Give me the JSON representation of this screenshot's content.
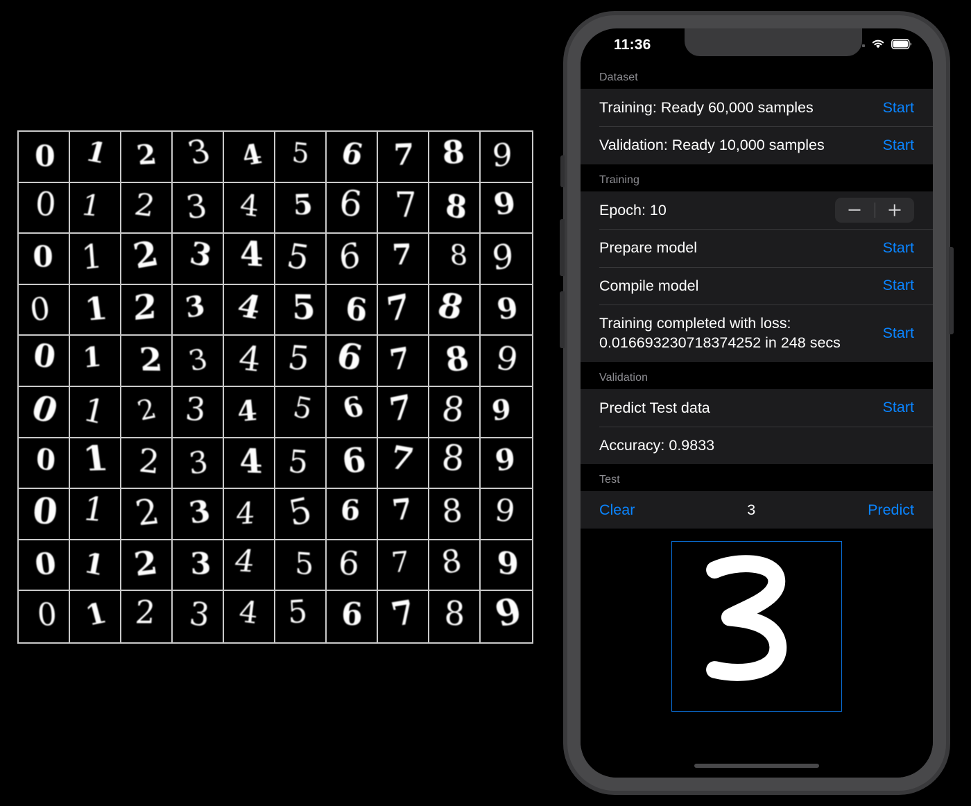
{
  "phone": {
    "status_bar": {
      "time": "11:36",
      "signal_icon": "signal-dots-icon",
      "wifi_icon": "wifi-icon",
      "battery_icon": "battery-icon"
    },
    "home_indicator": "home-indicator"
  },
  "app": {
    "sections": [
      {
        "header": "Dataset",
        "rows": [
          {
            "label": "Training: Ready   60,000 samples",
            "action": "Start"
          },
          {
            "label": "Validation: Ready   10,000 samples",
            "action": "Start"
          }
        ]
      },
      {
        "header": "Training",
        "rows": [
          {
            "label": "Epoch:  10",
            "control": "stepper"
          },
          {
            "label": "Prepare model",
            "action": "Start"
          },
          {
            "label": "Compile model",
            "action": "Start"
          },
          {
            "label": "Training completed with loss: 0.016693230718374252 in 248 secs",
            "action": "Start"
          }
        ]
      },
      {
        "header": "Validation",
        "rows": [
          {
            "label": "Predict Test data",
            "action": "Start"
          },
          {
            "label": "Accuracy: 0.9833",
            "action": ""
          }
        ]
      },
      {
        "header": "Test",
        "rows": [
          {
            "clear": "Clear",
            "value": "3",
            "predict": "Predict"
          }
        ]
      }
    ],
    "epoch": {
      "label": "Epoch:",
      "value": "10",
      "decrement_icon": "minus-icon",
      "increment_icon": "plus-icon"
    },
    "dataset": {
      "training_status": "Ready",
      "training_samples": "60,000 samples",
      "validation_status": "Ready",
      "validation_samples": "10,000 samples"
    },
    "training": {
      "loss": "0.016693230718374252",
      "duration_secs": "248"
    },
    "validation": {
      "accuracy": "0.9833"
    },
    "test": {
      "drawn_digit": "3",
      "canvas_border_color": "#0a6fd8",
      "stroke_color": "#ffffff"
    },
    "colors": {
      "accent": "#0a84ff",
      "row_background": "#1c1c1e",
      "section_background": "#000000",
      "separator": "#38383a",
      "section_header_text": "#8e8e93",
      "primary_text": "#ffffff"
    }
  },
  "mnist": {
    "title": "mnist-sample-grid",
    "columns": 10,
    "rows": 10,
    "column_digits": [
      "0",
      "1",
      "2",
      "3",
      "4",
      "5",
      "6",
      "7",
      "8",
      "9"
    ],
    "grid_line_color": "#c9c9c9",
    "background": "#000000",
    "digit_color": "#fdfdfd",
    "cells": [
      [
        "0",
        "1",
        "2",
        "3",
        "4",
        "5",
        "6",
        "7",
        "8",
        "9"
      ],
      [
        "0",
        "1",
        "2",
        "3",
        "4",
        "5",
        "6",
        "7",
        "8",
        "9"
      ],
      [
        "0",
        "1",
        "2",
        "3",
        "4",
        "5",
        "6",
        "7",
        "8",
        "9"
      ],
      [
        "0",
        "1",
        "2",
        "3",
        "4",
        "5",
        "6",
        "7",
        "8",
        "9"
      ],
      [
        "0",
        "1",
        "2",
        "3",
        "4",
        "5",
        "6",
        "7",
        "8",
        "9"
      ],
      [
        "0",
        "1",
        "2",
        "3",
        "4",
        "5",
        "6",
        "7",
        "8",
        "9"
      ],
      [
        "0",
        "1",
        "2",
        "3",
        "4",
        "5",
        "6",
        "7",
        "8",
        "9"
      ],
      [
        "0",
        "1",
        "2",
        "3",
        "4",
        "5",
        "6",
        "7",
        "8",
        "9"
      ],
      [
        "0",
        "1",
        "2",
        "3",
        "4",
        "5",
        "6",
        "7",
        "8",
        "9"
      ],
      [
        "0",
        "1",
        "2",
        "3",
        "4",
        "5",
        "6",
        "7",
        "8",
        "9"
      ]
    ]
  }
}
